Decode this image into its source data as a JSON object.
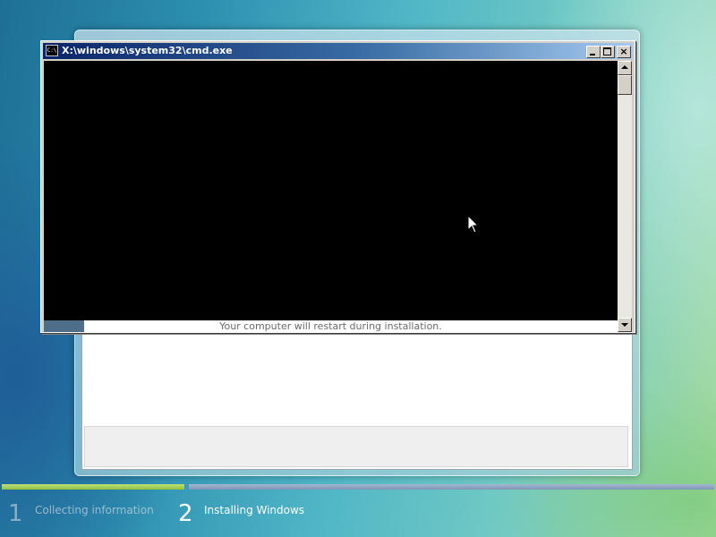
{
  "cmd_window": {
    "icon_text": "C:\\",
    "title": "X:\\windows\\system32\\cmd.exe",
    "restart_note": "Your computer will restart during installation.",
    "strip_progress_fraction": 0.07
  },
  "setup_steps": {
    "items": [
      {
        "number": "1",
        "label": "Collecting information",
        "state": "completed"
      },
      {
        "number": "2",
        "label": "Installing Windows",
        "state": "current"
      }
    ]
  },
  "icons": {
    "app_icon": "console-icon",
    "minimize": "minimize-icon",
    "maximize": "maximize-icon",
    "close": "close-icon",
    "scroll_up": "arrow-up-icon",
    "scroll_down": "arrow-down-icon",
    "cursor": "mouse-pointer-icon"
  },
  "colors": {
    "titlebar_start": "#0a246a",
    "titlebar_end": "#a6caf0",
    "console_bg": "#000000",
    "step1_bar": "#8fc23e",
    "step2_bar": "#7f95b6"
  }
}
